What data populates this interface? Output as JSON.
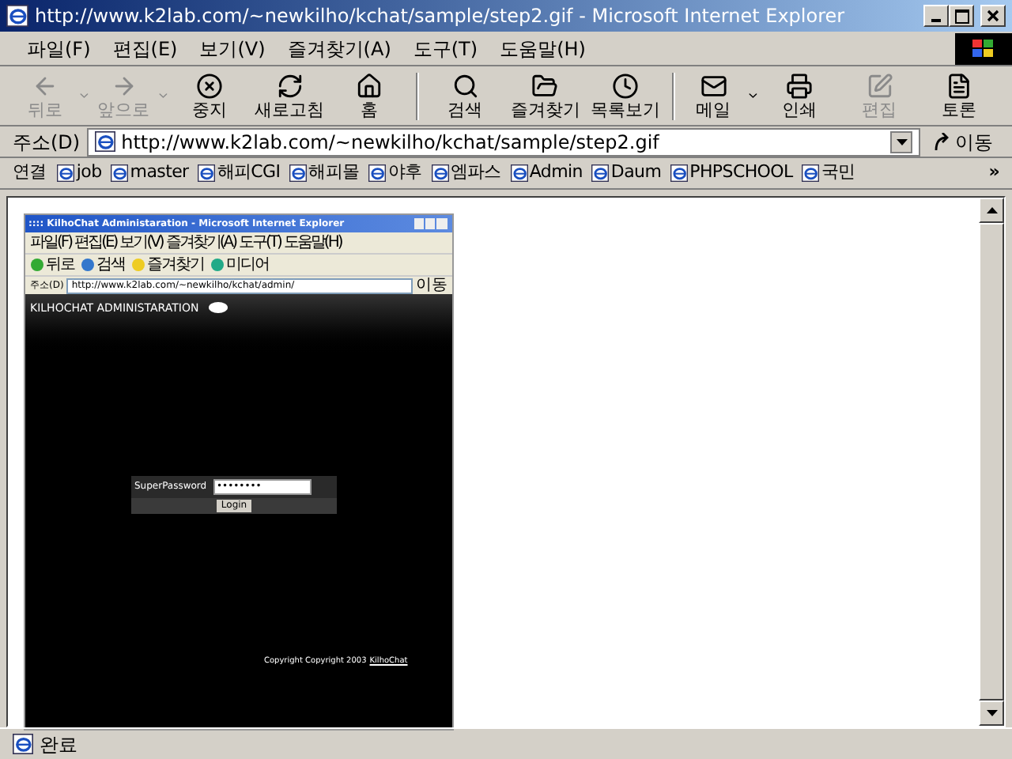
{
  "window": {
    "title": "http://www.k2lab.com/~newkilho/kchat/sample/step2.gif - Microsoft Internet Explorer"
  },
  "menu": [
    "파일(F)",
    "편집(E)",
    "보기(V)",
    "즐겨찾기(A)",
    "도구(T)",
    "도움말(H)"
  ],
  "toolbar": [
    {
      "kind": "back",
      "label": "뒤로",
      "disabled": true,
      "dropdown": true,
      "group_end": false
    },
    {
      "kind": "forward",
      "label": "앞으로",
      "disabled": true,
      "dropdown": true,
      "group_end": false
    },
    {
      "kind": "stop",
      "label": "중지",
      "disabled": false,
      "dropdown": false,
      "group_end": false
    },
    {
      "kind": "refresh",
      "label": "새로고침",
      "disabled": false,
      "dropdown": false,
      "group_end": false
    },
    {
      "kind": "home",
      "label": "홈",
      "disabled": false,
      "dropdown": false,
      "group_end": true
    },
    {
      "kind": "search",
      "label": "검색",
      "disabled": false,
      "dropdown": false,
      "group_end": false
    },
    {
      "kind": "favorites",
      "label": "즐겨찾기",
      "disabled": false,
      "dropdown": false,
      "group_end": false
    },
    {
      "kind": "history",
      "label": "목록보기",
      "disabled": false,
      "dropdown": false,
      "group_end": true
    },
    {
      "kind": "mail",
      "label": "메일",
      "disabled": false,
      "dropdown": true,
      "group_end": false
    },
    {
      "kind": "print",
      "label": "인쇄",
      "disabled": false,
      "dropdown": false,
      "group_end": false
    },
    {
      "kind": "edit",
      "label": "편집",
      "disabled": true,
      "dropdown": false,
      "group_end": false
    },
    {
      "kind": "discuss",
      "label": "토론",
      "disabled": false,
      "dropdown": false,
      "group_end": false
    }
  ],
  "address": {
    "label": "주소(D)",
    "value": "http://www.k2lab.com/~newkilho/kchat/sample/step2.gif",
    "go": "이동"
  },
  "links": {
    "label": "연결",
    "items": [
      "job",
      "master",
      "해피CGI",
      "해피몰",
      "야후",
      "엠파스",
      "Admin",
      "Daum",
      "PHPSCHOOL",
      "국민"
    ],
    "more": "»"
  },
  "inner": {
    "title": ":::: KilhoChat Administaration - Microsoft Internet Explorer",
    "menu": [
      "파일(F)",
      "편집(E)",
      "보기(V)",
      "즐겨찾기(A)",
      "도구(T)",
      "도움말(H)"
    ],
    "toolbar": [
      "뒤로",
      "검색",
      "즐겨찾기",
      "미디어"
    ],
    "address": {
      "label": "주소(D)",
      "value": "http://www.k2lab.com/~newkilho/kchat/admin/",
      "go": "이동"
    },
    "heading": "KILHOCHAT ADMINISTARATION",
    "login": {
      "label": "SuperPassword",
      "value": "••••••••",
      "button": "Login"
    },
    "copyright": "Copyright Copyright 2003",
    "copyright_link": "KilhoChat"
  },
  "status_bar": {
    "text": "완료"
  }
}
